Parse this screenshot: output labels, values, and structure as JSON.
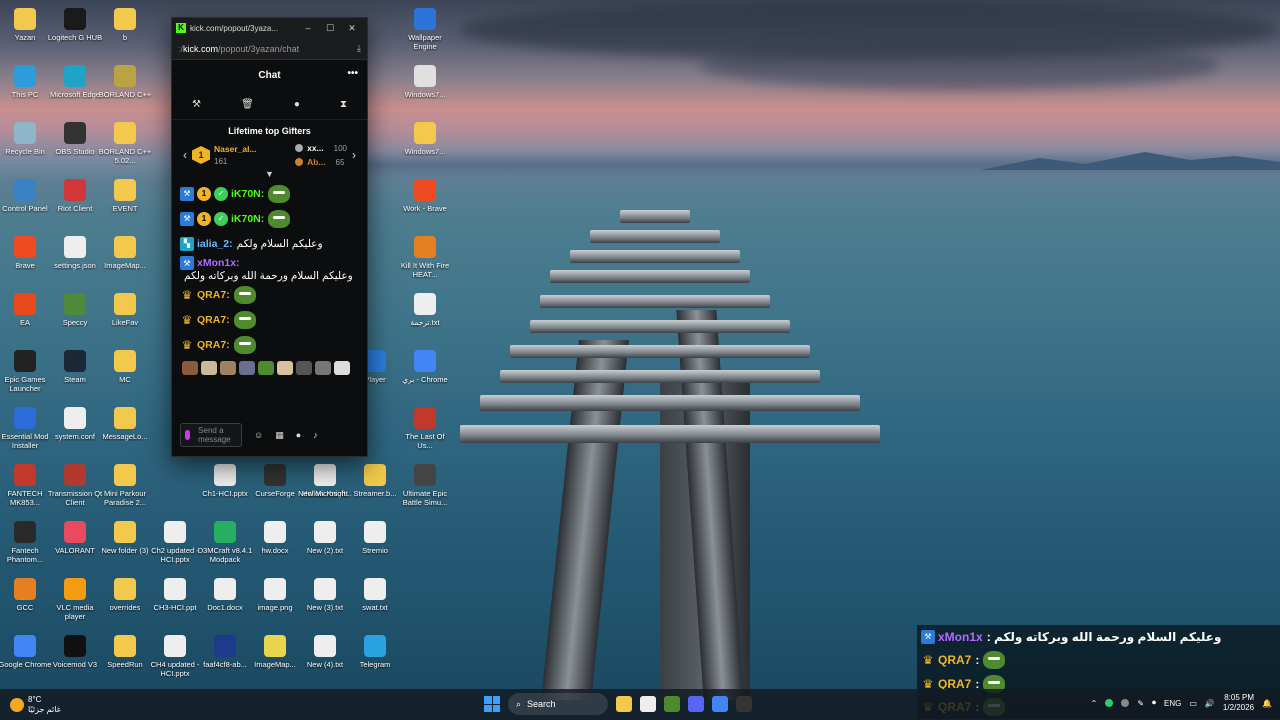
{
  "desktop": {
    "icons": [
      {
        "label": "Yazan",
        "color": "#f2c94c"
      },
      {
        "label": "Logitech G HUB",
        "color": "#1a1a1a"
      },
      {
        "label": "b",
        "color": "#f2c94c"
      },
      {
        "label": "This PC",
        "color": "#2d9cdb"
      },
      {
        "label": "Microsoft Edge",
        "color": "#1fa3c9"
      },
      {
        "label": "BORLAND C++",
        "color": "#b9a343"
      },
      {
        "label": "Recycle Bin",
        "color": "#8fb5c8"
      },
      {
        "label": "OBS Studio",
        "color": "#333333"
      },
      {
        "label": "BORLAND C++ 5.02...",
        "color": "#f2c94c"
      },
      {
        "label": "Control Panel",
        "color": "#3b82c4"
      },
      {
        "label": "Riot Client",
        "color": "#d13639"
      },
      {
        "label": "EVENT",
        "color": "#f2c94c"
      },
      {
        "label": "Brave",
        "color": "#f04a23"
      },
      {
        "label": "settings.json",
        "color": "#eeeeee"
      },
      {
        "label": "ImageMap...",
        "color": "#f2c94c"
      },
      {
        "label": "EA",
        "color": "#e84a1c"
      },
      {
        "label": "Speccy",
        "color": "#4f8a3a"
      },
      {
        "label": "LikeFav",
        "color": "#f2c94c"
      },
      {
        "label": "Epic Games Launcher",
        "color": "#222222"
      },
      {
        "label": "Steam",
        "color": "#1b2838"
      },
      {
        "label": "MC",
        "color": "#f2c94c"
      },
      {
        "label": "Essential Mod Installer",
        "color": "#2b6cd9"
      },
      {
        "label": "system.conf",
        "color": "#eeeeee"
      },
      {
        "label": "MessageLo...",
        "color": "#f2c94c"
      },
      {
        "label": "FANTECH MK853...",
        "color": "#c0392b"
      },
      {
        "label": "Transmission Qt Client",
        "color": "#b03a2e"
      },
      {
        "label": "Mini Parkour Paradise 2...",
        "color": "#f2c94c"
      },
      {
        "label": "Fantech Phantom...",
        "color": "#2a2a2a"
      },
      {
        "label": "VALORANT",
        "color": "#e84a5f"
      },
      {
        "label": "New folder (3)",
        "color": "#f2c94c"
      },
      {
        "label": "GCC",
        "color": "#e67e22"
      },
      {
        "label": "VLC media player",
        "color": "#f39c12"
      },
      {
        "label": "overrides",
        "color": "#f2c94c"
      },
      {
        "label": "Google Chrome",
        "color": "#4285f4"
      },
      {
        "label": "Voicemod V3",
        "color": "#111111"
      },
      {
        "label": "SpeedRun",
        "color": "#f2c94c"
      },
      {
        "label": "Ch1-HCI.pptx",
        "color": "#eeeeee"
      },
      {
        "label": "CurseForge",
        "color": "#333333"
      },
      {
        "label": "Hollow Knight",
        "color": "#eeeeee"
      },
      {
        "label": "Ch2 updated - HCI.pptx",
        "color": "#eeeeee"
      },
      {
        "label": "D3MCraft v8.4.1 Modpack",
        "color": "#27ae60"
      },
      {
        "label": "hw.docx",
        "color": "#eeeeee"
      },
      {
        "label": "CH3-HCI.ppt",
        "color": "#eeeeee"
      },
      {
        "label": "Doc1.docx",
        "color": "#eeeeee"
      },
      {
        "label": "image.png",
        "color": "#eeeeee"
      },
      {
        "label": "CH4 updated -HCI.pptx",
        "color": "#eeeeee"
      },
      {
        "label": "faaf4cf8-ab...",
        "color": "#1e3a8a"
      },
      {
        "label": "ImageMap...",
        "color": "#e8d44d"
      },
      {
        "label": "Wallpaper Engine",
        "color": "#2d74da"
      },
      {
        "label": "Windows7...",
        "color": "#e0e0e0"
      },
      {
        "label": "Windows7...",
        "color": "#f2c94c"
      },
      {
        "label": "Work - Brave",
        "color": "#f04a23"
      },
      {
        "label": "Kill It With Fire HEAT...",
        "color": "#e67e22"
      },
      {
        "label": "ترجمة.txt",
        "color": "#eeeeee"
      },
      {
        "label": "Player",
        "color": "#2a7de1"
      },
      {
        "label": "بري - Chrome",
        "color": "#4285f4"
      },
      {
        "label": "The Last Of Us...",
        "color": "#c0392b"
      },
      {
        "label": "Streamer.b...",
        "color": "#f2c94c"
      },
      {
        "label": "Ultimate Epic Battle Simu...",
        "color": "#444444"
      },
      {
        "label": "New Microsoft...",
        "color": "#eeeeee"
      },
      {
        "label": "New (2).txt",
        "color": "#eeeeee"
      },
      {
        "label": "Stremio",
        "color": "#eeeeee"
      },
      {
        "label": "New (3).txt",
        "color": "#eeeeee"
      },
      {
        "label": "swat.txt",
        "color": "#eeeeee"
      },
      {
        "label": "New (4).txt",
        "color": "#eeeeee"
      },
      {
        "label": "Telegram",
        "color": "#2aa3df"
      }
    ]
  },
  "popout": {
    "title": "kick.com/popout/3yaza...",
    "url_prefix": "ː/",
    "url_domain": "kick.com",
    "url_path": "/popout/3yazan/chat",
    "header": "Chat",
    "more_label": "•••",
    "gifters": {
      "title": "Lifetime top Gifters",
      "first": {
        "rank": "1",
        "name": "Naser_al...",
        "count": "161"
      },
      "second": {
        "name": "xx...",
        "count": "100"
      },
      "third": {
        "name": "Ab...",
        "count": "65"
      }
    },
    "messages": [
      {
        "user": "iK70N:",
        "text": "",
        "color": "#53fc18",
        "badges": [
          "mod",
          "one",
          "ver"
        ],
        "emote": true
      },
      {
        "user": "iK70N:",
        "text": "",
        "color": "#53fc18",
        "badges": [
          "mod",
          "one",
          "ver"
        ],
        "emote": true
      },
      {
        "user": "ialia_2:",
        "text": "وعليكم السلام ولكم",
        "color": "#6fb8ff",
        "badges": [
          "sub"
        ],
        "emote": false
      },
      {
        "user": "xMon1x:",
        "text": "وعليكم السلام ورحمة الله وبركاته ولكم",
        "color": "#b26bff",
        "badges": [
          "mod"
        ],
        "emote": false
      },
      {
        "user": "QRA7:",
        "text": "",
        "color": "#f0b429",
        "badges": [
          "crown"
        ],
        "emote": true
      },
      {
        "user": "QRA7:",
        "text": "",
        "color": "#f0b429",
        "badges": [
          "crown"
        ],
        "emote": true
      },
      {
        "user": "QRA7:",
        "text": "",
        "color": "#f0b429",
        "badges": [
          "crown"
        ],
        "emote": true
      }
    ],
    "input_placeholder": "Send a message"
  },
  "overlay": [
    {
      "user": "xMon1x",
      "text": ": وعليكم السلام ورحمة الله وبركاته ولكم",
      "color": "#b26bff",
      "badge": "mod"
    },
    {
      "user": "QRA7",
      "text": ":",
      "color": "#f0b429",
      "badge": "crown"
    },
    {
      "user": "QRA7",
      "text": ":",
      "color": "#f0b429",
      "badge": "crown"
    },
    {
      "user": "QRA7",
      "text": ":",
      "color": "#f0b429",
      "badge": "crown"
    }
  ],
  "taskbar": {
    "temp": "8°C",
    "weather_text": "غائم جزئيًا",
    "search_label": "Search",
    "lang": "ENG",
    "time": "8:05 PM",
    "date": "1/2/2026"
  }
}
